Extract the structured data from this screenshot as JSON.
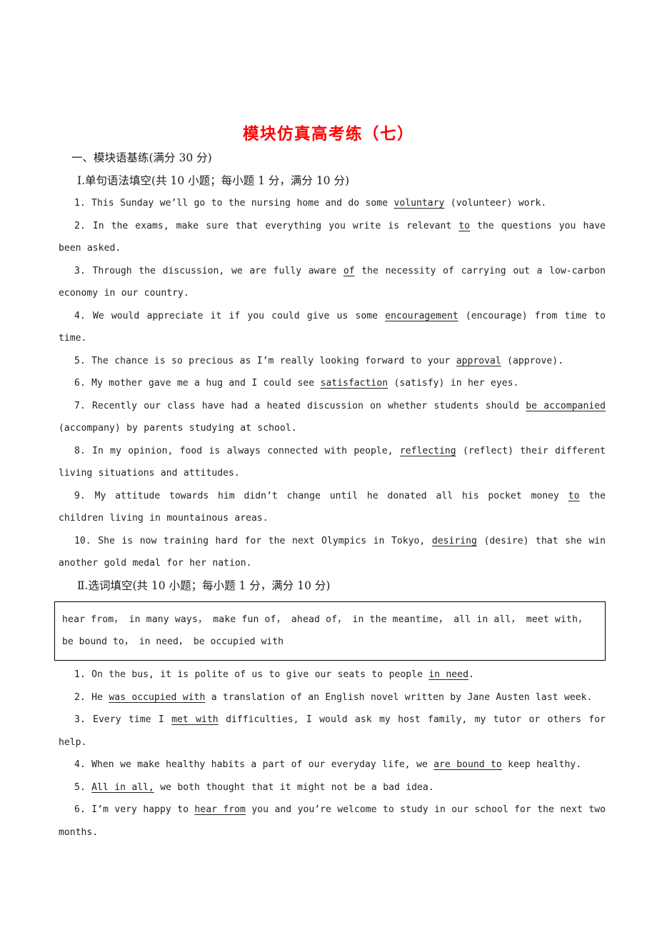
{
  "document": {
    "title": "模块仿真高考练（七）",
    "title_color": "#ff0000",
    "section_one_heading": "一、模块语基练(满分 30 分)",
    "part_one_heading": "Ⅰ.单句语法填空(共 10 小题；每小题 1 分，满分 10 分)",
    "part_two_heading": "Ⅱ.选词填空(共 10 小题；每小题 1 分，满分 10 分)"
  },
  "part_one_items": [
    {
      "number": "1.",
      "pre": "This Sunday we’ll go to the nursing home and do some ",
      "answer": "voluntary",
      "post": " (volunteer) work."
    },
    {
      "number": "2.",
      "pre": "In the exams, make sure that everything you write is relevant ",
      "answer": "to",
      "post": " the questions you have been asked."
    },
    {
      "number": "3.",
      "pre": "Through the discussion, we are fully aware ",
      "answer": "of",
      "post": " the necessity of carrying out a low-carbon economy in our country."
    },
    {
      "number": "4.",
      "pre": "We would appreciate it if you could give us some ",
      "answer": "encouragement",
      "post": " (encourage) from time to time."
    },
    {
      "number": "5.",
      "pre": "The chance is so precious as I’m really looking forward to your ",
      "answer": "approval",
      "post": " (approve)."
    },
    {
      "number": "6.",
      "pre": "My mother gave me a hug and I could see ",
      "answer": "satisfaction",
      "post": " (satisfy) in her eyes."
    },
    {
      "number": "7.",
      "pre": "Recently our class have had a heated discussion on whether students should ",
      "answer": "be accompanied",
      "post": " (accompany) by parents studying at school."
    },
    {
      "number": "8.",
      "pre": "In my opinion, food is always connected with people, ",
      "answer": "reflecting",
      "post": " (reflect) their different living situations and attitudes."
    },
    {
      "number": "9.",
      "pre": "My attitude towards him didn’t change until he donated all his pocket money ",
      "answer": "to",
      "post": " the children living in mountainous areas."
    },
    {
      "number": "10.",
      "pre": "She is now training hard for the next Olympics in Tokyo, ",
      "answer": "desiring",
      "post": " (desire) that she win another gold medal for her nation."
    }
  ],
  "word_bank": {
    "line_one": "hear from，  in many ways，  make fun of，  ahead of，  in the meantime，  all in all，  meet with，",
    "line_two": "be bound to，  in need，  be occupied with",
    "phrases": [
      "hear from",
      "in many ways",
      "make fun of",
      "ahead of",
      "in the meantime",
      "all in all",
      "meet with",
      "be bound to",
      "in need",
      "be occupied with"
    ]
  },
  "part_two_items": [
    {
      "number": "1.",
      "pre": "On the bus, it is polite of us to give our seats to people ",
      "answer": "in need",
      "post": "."
    },
    {
      "number": "2.",
      "pre": "He ",
      "answer": "was occupied with",
      "post": " a translation of an English novel written by Jane Austen last week."
    },
    {
      "number": "3.",
      "pre": "Every time I ",
      "answer": "met with",
      "post": " difficulties, I would ask my host family, my tutor or others for help."
    },
    {
      "number": "4.",
      "pre": "When we make healthy habits a part of our everyday life, we ",
      "answer": "are bound to",
      "post": " keep healthy."
    },
    {
      "number": "5.",
      "pre": "",
      "answer": "All in all,",
      "post": " we both thought that it might not be a bad idea."
    },
    {
      "number": "6.",
      "pre": "I’m very happy to ",
      "answer": "hear from",
      "post": " you and you’re welcome to study in our school for the next two months."
    }
  ]
}
